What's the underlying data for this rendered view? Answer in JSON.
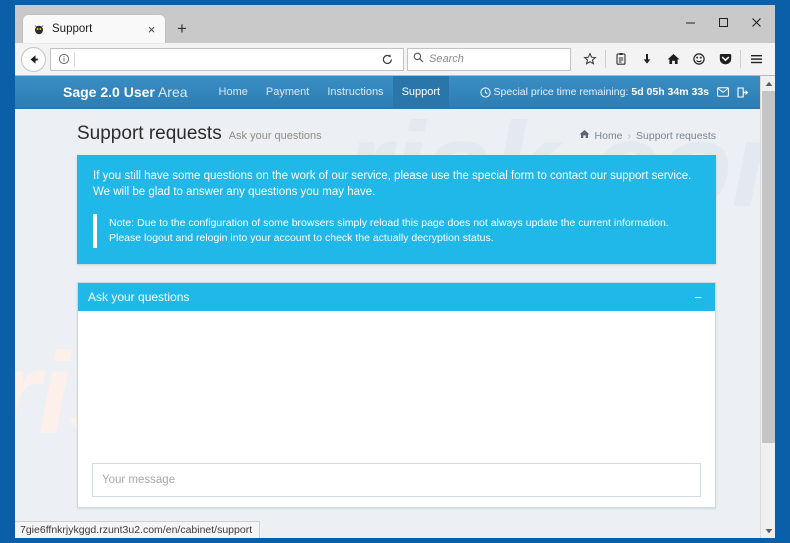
{
  "browser": {
    "tab": {
      "title": "Support",
      "favicon": "bug-favicon",
      "close_label": "×",
      "newtab_label": "+"
    },
    "window_controls": {
      "minimize": "minimize-icon",
      "maximize": "maximize-icon",
      "close": "close-icon"
    },
    "toolbar": {
      "back": "back-arrow-icon",
      "identity": "info-icon",
      "url_value": "",
      "reload": "reload-icon",
      "search_placeholder": "Search",
      "search_value": "",
      "icons": [
        "bookmark-star-icon",
        "library-icon",
        "downloads-icon",
        "home-icon",
        "account-icon",
        "pocket-icon",
        "menu-icon"
      ]
    },
    "status_url": "7gie6ffnkrjykggd.rzunt3u2.com/en/cabinet/support"
  },
  "site": {
    "brand": {
      "bold": "Sage 2.0 User",
      "light": "Area"
    },
    "nav": [
      {
        "label": "Home",
        "active": false
      },
      {
        "label": "Payment",
        "active": false
      },
      {
        "label": "Instructions",
        "active": false
      },
      {
        "label": "Support",
        "active": true
      }
    ],
    "header_right": {
      "clock_icon": "clock-icon",
      "label": "Special price time remaining:",
      "timer": "5d 05h 34m 33s",
      "mail_icon": "envelope-icon",
      "logout_icon": "logout-icon"
    },
    "page": {
      "title": "Support requests",
      "subtitle": "Ask your questions",
      "breadcrumb": {
        "home_icon": "home-icon",
        "home": "Home",
        "separator": "›",
        "current": "Support requests"
      }
    },
    "alert": {
      "line1": "If you still have some questions on the work of our service, please use the special form to contact our support service.",
      "line2": "We will be glad to answer any questions you may have.",
      "note_line1": "Note: Due to the configuration of some browsers simply reload this page does not always update the current information.",
      "note_line2": "Please logout and relogin into your account to check the actually decryption status."
    },
    "panel": {
      "title": "Ask your questions",
      "collapse_label": "−",
      "message_placeholder": "Your message",
      "message_value": ""
    },
    "watermark": "risk.com",
    "colors": {
      "header_blue": "#2c7db4",
      "accent_cyan": "#1fb8e8",
      "page_bg": "#eceff3",
      "frame_blue": "#0b5ea8"
    }
  }
}
